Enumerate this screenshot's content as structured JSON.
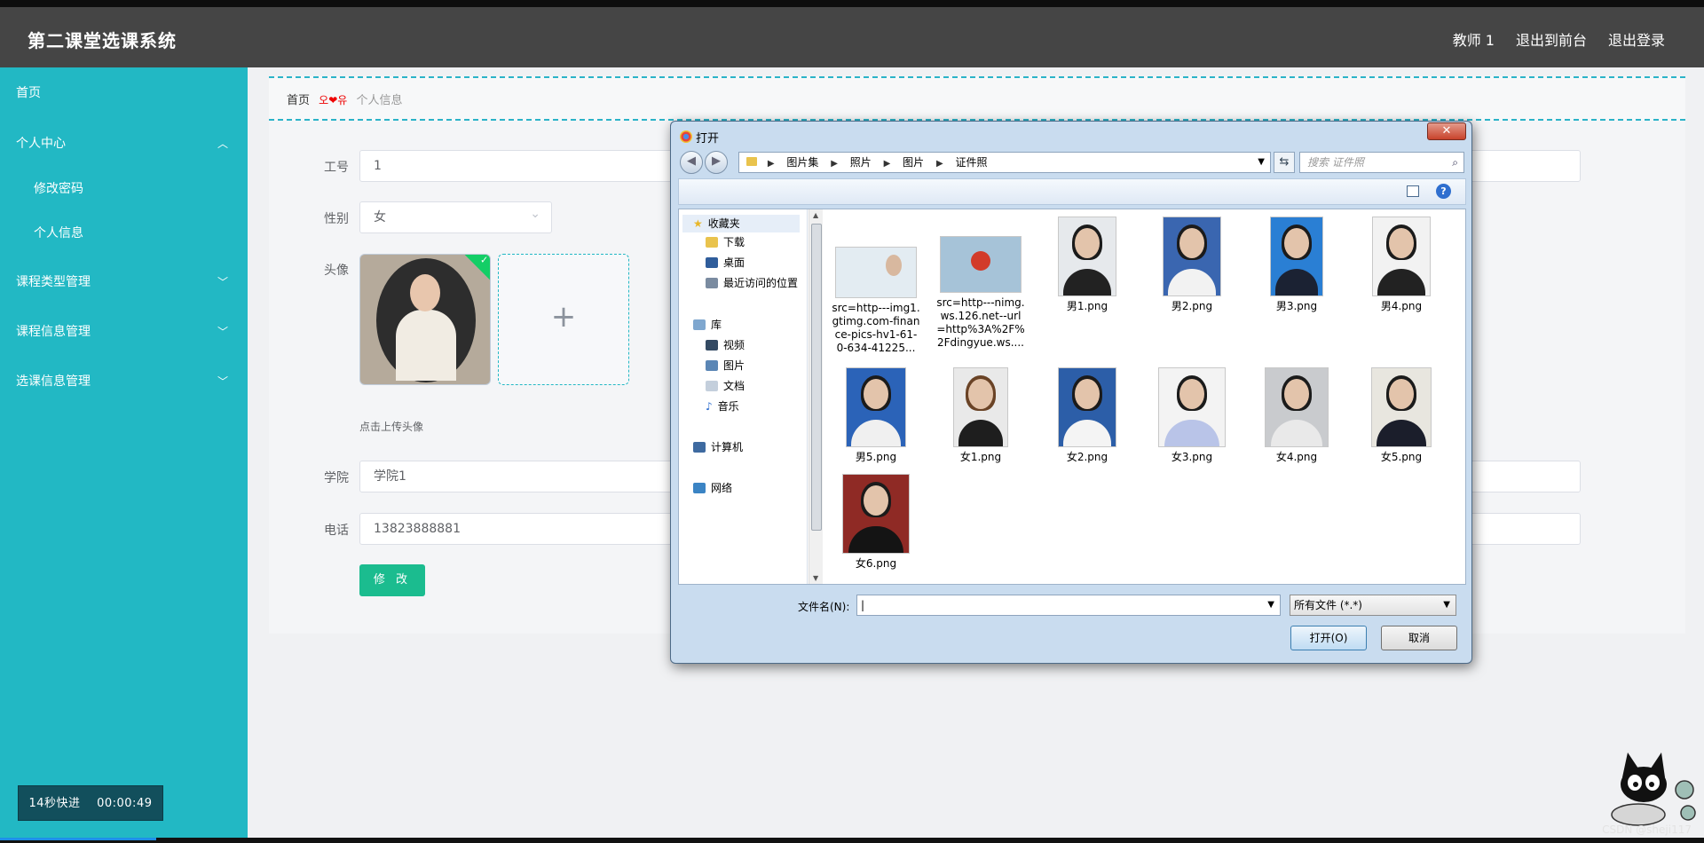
{
  "app": {
    "title": "第二课堂选课系统",
    "header_links": [
      "教师 1",
      "退出到前台",
      "退出登录"
    ]
  },
  "sidebar": {
    "items": [
      {
        "label": "首页"
      },
      {
        "label": "个人中心"
      },
      {
        "label": "修改密码"
      },
      {
        "label": "个人信息"
      },
      {
        "label": "课程类型管理"
      },
      {
        "label": "课程信息管理"
      },
      {
        "label": "选课信息管理"
      }
    ],
    "timer_label": "14秒快进",
    "timer_time": "00:00:49"
  },
  "breadcrumb": {
    "home": "首页",
    "separator": "오❤유",
    "current": "个人信息"
  },
  "form": {
    "id_label": "工号",
    "id_value": "1",
    "gender_label": "性别",
    "gender_value": "女",
    "avatar_label": "头像",
    "upload_hint": "点击上传头像",
    "upload_plus": "+",
    "college_label": "学院",
    "college_value": "学院1",
    "phone_label": "电话",
    "phone_value": "13823888881",
    "submit_label": "修 改"
  },
  "dialog": {
    "title": "打开",
    "close_label": "✕",
    "path": [
      "图片集",
      "照片",
      "图片",
      "证件照"
    ],
    "search_placeholder": "搜索 证件照",
    "nav": {
      "favorites": "收藏夹",
      "favorites_items": [
        "下载",
        "桌面",
        "最近访问的位置"
      ],
      "library": "库",
      "library_items": [
        "视频",
        "图片",
        "文档",
        "音乐"
      ],
      "computer": "计算机",
      "network": "网络"
    },
    "files": [
      "src=http---img1.gtimg.com-finance-pics-hv1-61-0-634-41225...",
      "src=http---nimg.ws.126.net--url=http%3A%2F%2Fdingyue.ws....",
      "男1.png",
      "男2.png",
      "男3.png",
      "男4.png",
      "男5.png",
      "女1.png",
      "女2.png",
      "女3.png",
      "女4.png",
      "女5.png",
      "女6.png"
    ],
    "filename_label": "文件名(N):",
    "filename_value": "",
    "filetype_value": "所有文件 (*.*)",
    "open_label": "打开(O)",
    "cancel_label": "取消"
  },
  "watermark": "CSDN @sheji117",
  "colors": {
    "header_bg": "#454545",
    "sidebar_bg": "#22b8c4",
    "accent_green": "#1bbc8f"
  }
}
